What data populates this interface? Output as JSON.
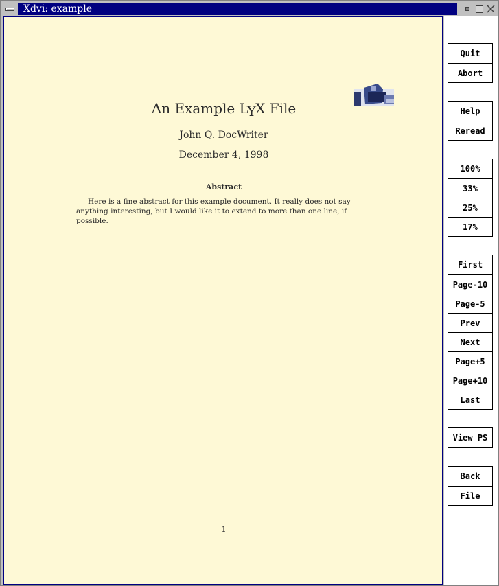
{
  "window": {
    "title": "Xdvi:  example"
  },
  "document": {
    "title_pre": "An Example L",
    "title_y": "Y",
    "title_post": "X File",
    "author": "John Q. DocWriter",
    "date": "December 4, 1998",
    "abstract_heading": "Abstract",
    "abstract_text": "Here is a fine abstract for this example document. It really does not say anything interesting, but I would like it to extend to more than one line, if possible.",
    "page_number": "1"
  },
  "sidebar": {
    "groups": [
      [
        "Quit",
        "Abort"
      ],
      [
        "Help",
        "Reread"
      ],
      [
        "100%",
        "33%",
        "25%",
        "17%"
      ],
      [
        "First",
        "Page-10",
        "Page-5",
        "Prev",
        "Next",
        "Page+5",
        "Page+10",
        "Last"
      ],
      [
        "View PS"
      ],
      [
        "Back",
        "File"
      ]
    ]
  },
  "colors": {
    "titlebar": "#000080",
    "page": "#fef9d6"
  }
}
